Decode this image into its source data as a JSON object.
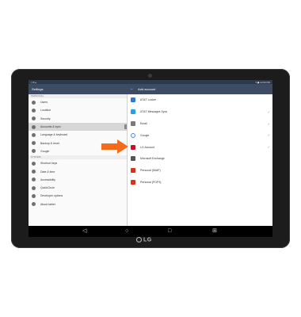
{
  "statusbar": {
    "left_text": "▪ ✉ ▴",
    "right_text": "▾ ◼ 12:00 PM"
  },
  "left_header": {
    "title": "Settings"
  },
  "right_header": {
    "back_glyph": "←",
    "title": "Add account"
  },
  "left_sections": [
    {
      "section": "PERSONAL",
      "items": [
        {
          "label": "Users"
        },
        {
          "label": "Location"
        },
        {
          "label": "Security"
        },
        {
          "label": "Accounts & sync",
          "selected": true
        },
        {
          "label": "Language & keyboard"
        },
        {
          "label": "Backup & reset"
        },
        {
          "label": "Google"
        }
      ]
    },
    {
      "section": "SYSTEM",
      "items": [
        {
          "label": "Shortcut keys"
        },
        {
          "label": "Date & time"
        },
        {
          "label": "Accessibility"
        },
        {
          "label": "QuickCircle"
        },
        {
          "label": "Developer options"
        },
        {
          "label": "About tablet"
        }
      ]
    }
  ],
  "accounts": [
    {
      "label": "AT&T Locker",
      "icon": "cloud-icon",
      "color": "#2e7bd6",
      "checked": false
    },
    {
      "label": "AT&T Messages Sync",
      "icon": "att-globe-icon",
      "color": "#27a3d9",
      "checked": true
    },
    {
      "label": "Email",
      "icon": "email-icon",
      "color": "#7a7a7a",
      "checked": true
    },
    {
      "label": "Google",
      "icon": "google-icon",
      "color": "#ffffff",
      "checked": true
    },
    {
      "label": "LG Account",
      "icon": "lg-logo-icon",
      "color": "#c8102e",
      "checked": true
    },
    {
      "label": "Microsoft Exchange",
      "icon": "exchange-icon",
      "color": "#555555",
      "checked": false
    },
    {
      "label": "Personal (IMAP)",
      "icon": "gmail-icon",
      "color": "#d93025",
      "checked": false
    },
    {
      "label": "Personal (POP3)",
      "icon": "gmail-icon",
      "color": "#d93025",
      "checked": false
    }
  ],
  "check_glyph": "✓",
  "navbar": {
    "back": "◁",
    "home": "○",
    "recent": "□",
    "extra": "⊞"
  },
  "brand": "LG",
  "colors": {
    "header": "#3d4b63",
    "statusbar": "#2c3a4f",
    "arrow": "#f26c1c",
    "selected": "#d6d6d6"
  }
}
